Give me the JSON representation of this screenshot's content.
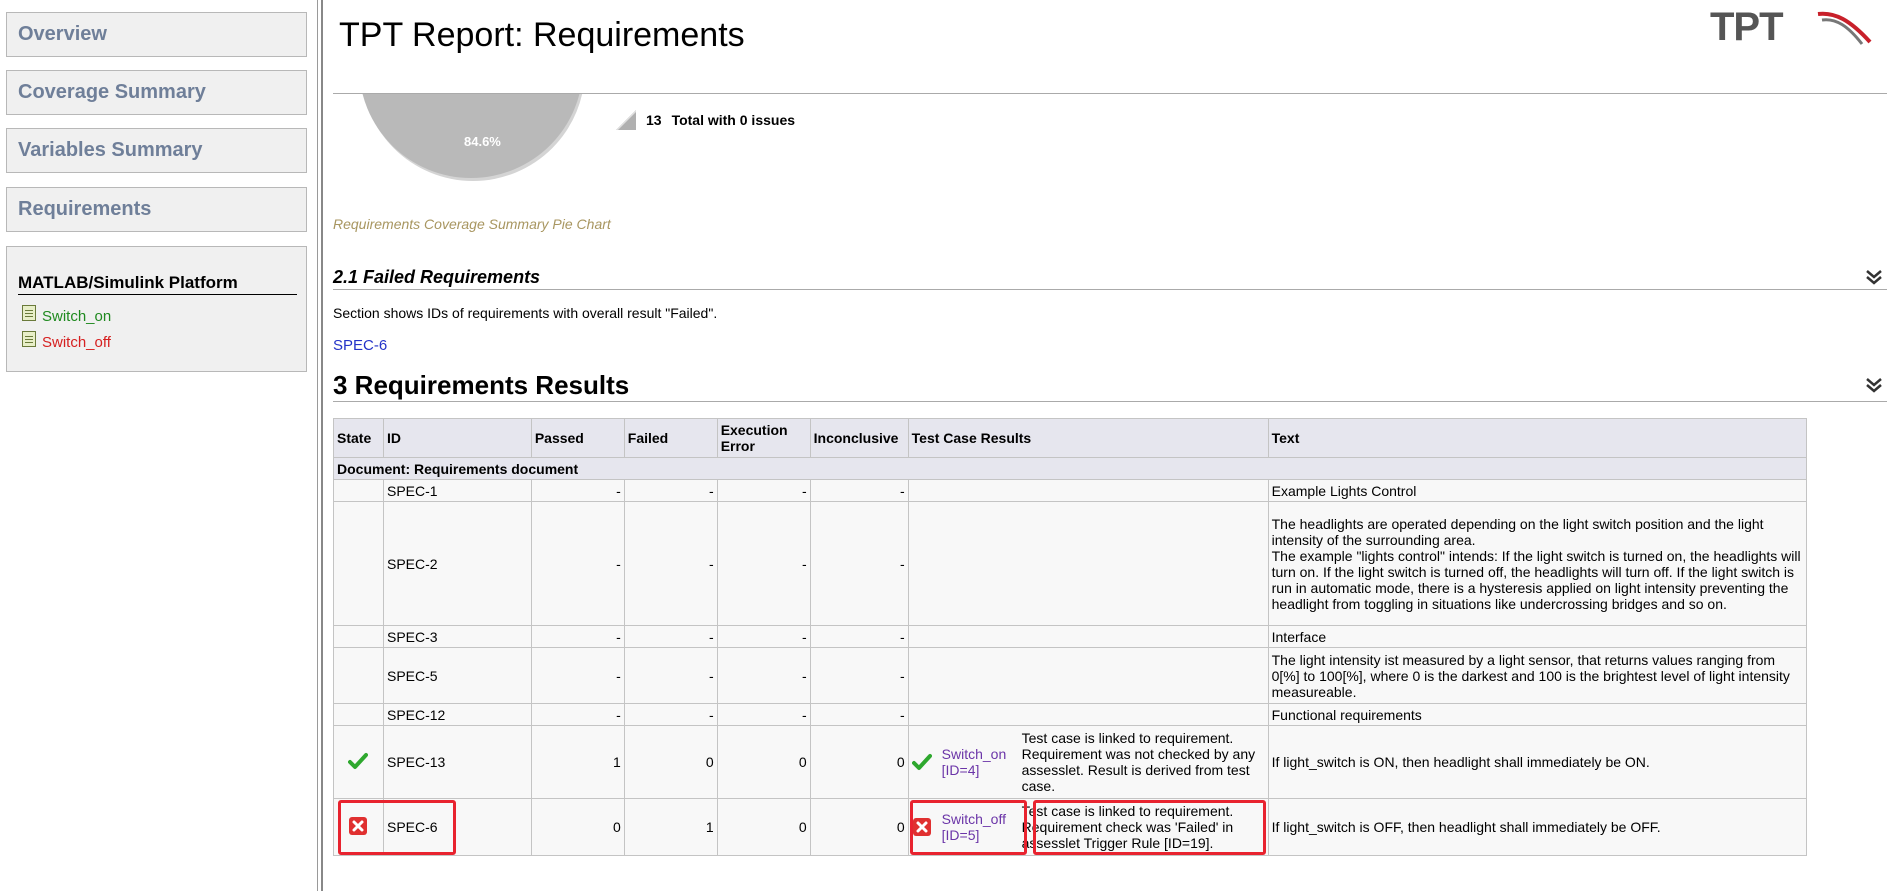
{
  "sidebar": {
    "nav": [
      "Overview",
      "Coverage Summary",
      "Variables Summary",
      "Requirements"
    ],
    "platform_title": "MATLAB/Simulink Platform",
    "test_cases": [
      {
        "label": "Switch_on",
        "color": "#1f8a1f"
      },
      {
        "label": "Switch_off",
        "color": "#d62020"
      }
    ]
  },
  "header": {
    "title": "TPT Report: Requirements",
    "logo_text": "TPT"
  },
  "coverage_chart": {
    "pie_label": "84.6%",
    "legend_count": "13",
    "legend_label": "Total with 0 issues",
    "caption": "Requirements Coverage Summary Pie Chart"
  },
  "failed_section": {
    "title": "2.1 Failed Requirements",
    "description": "Section shows IDs of requirements with overall result \"Failed\".",
    "link": "SPEC-6"
  },
  "results_section": {
    "title": "3 Requirements Results"
  },
  "table": {
    "headers": {
      "state": "State",
      "id": "ID",
      "passed": "Passed",
      "failed": "Failed",
      "exec_error_1": "Execution",
      "exec_error_2": "Error",
      "inconclusive": "Inconclusive",
      "tcr": "Test Case Results",
      "text": "Text"
    },
    "document_row": "Document: Requirements document",
    "rows": [
      {
        "id": "SPEC-1",
        "passed": "-",
        "failed": "-",
        "exec_error": "-",
        "inconclusive": "-",
        "text": "Example Lights Control"
      },
      {
        "id": "SPEC-2",
        "passed": "-",
        "failed": "-",
        "exec_error": "-",
        "inconclusive": "-",
        "text": "The headlights are operated depending on the light switch position and the light intensity of the surrounding area.\nThe example \"lights control\" intends: If the light switch is turned on, the headlights will turn on. If the light switch is turned off, the headlights will turn off. If the light switch is run in automatic mode, there is a hysteresis applied on light intensity preventing the headlight from toggling in situations like undercrossing bridges and so on."
      },
      {
        "id": "SPEC-3",
        "passed": "-",
        "failed": "-",
        "exec_error": "-",
        "inconclusive": "-",
        "text": "Interface"
      },
      {
        "id": "SPEC-5",
        "passed": "-",
        "failed": "-",
        "exec_error": "-",
        "inconclusive": "-",
        "text": "The light intensity ist measured by a light sensor, that returns values ranging from 0[%] to 100[%], where 0 is the darkest and 100 is the brightest level of light intensity measureable."
      },
      {
        "id": "SPEC-12",
        "passed": "-",
        "failed": "-",
        "exec_error": "-",
        "inconclusive": "-",
        "text": "Functional requirements"
      },
      {
        "id": "SPEC-13",
        "state": "passed-check-icon",
        "passed": "1",
        "failed": "0",
        "exec_error": "0",
        "inconclusive": "0",
        "tcr_link": "Switch_on [ID=4]",
        "tcr_note": "Test case is linked to requirement. Requirement was not checked by any assesslet. Result is derived from test case.",
        "text": "If light_switch is ON, then headlight shall immediately be ON."
      },
      {
        "id": "SPEC-6",
        "state": "failed-x-icon",
        "passed": "0",
        "failed": "1",
        "exec_error": "0",
        "inconclusive": "0",
        "tcr_link": "Switch_off [ID=5]",
        "tcr_note": "Test case is linked to requirement. Requirement check was 'Failed' in assesslet Trigger Rule [ID=19].",
        "text": "If light_switch is OFF, then headlight shall immediately be OFF."
      }
    ]
  },
  "colors": {
    "nav_text": "#6f7f99",
    "caption": "#a89660",
    "link_blue": "#2433c8",
    "tc_link_purple": "#6b35a8",
    "highlight_red": "#e8232f",
    "pass_green": "#2ea82e",
    "fail_red": "#e03030"
  }
}
